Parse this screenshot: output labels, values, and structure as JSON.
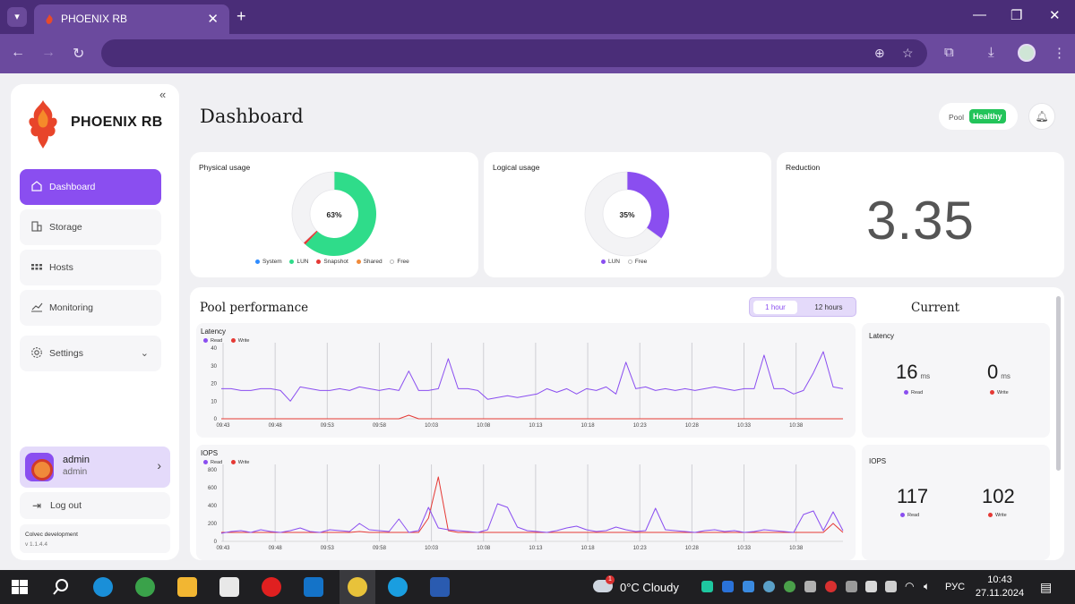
{
  "browser": {
    "tab_title": "PHOENIX RB",
    "tab_close": "✕",
    "new_tab": "+",
    "window_controls": [
      "—",
      "❐",
      "✕"
    ]
  },
  "sidebar": {
    "brand": "PHOENIX RB",
    "collapse": "«",
    "items": [
      {
        "label": "Dashboard",
        "icon": "home-icon"
      },
      {
        "label": "Storage",
        "icon": "building-icon"
      },
      {
        "label": "Hosts",
        "icon": "grid-icon"
      },
      {
        "label": "Monitoring",
        "icon": "chart-icon"
      },
      {
        "label": "Settings",
        "icon": "gear-icon"
      }
    ],
    "user": {
      "name": "admin",
      "role": "admin"
    },
    "logout": "Log out",
    "footer_line1": "Colvec development",
    "footer_line2": "v 1.1.4.4"
  },
  "header": {
    "title": "Dashboard",
    "pool_label": "Pool",
    "pool_status": "Healthy"
  },
  "cards": {
    "physical": {
      "title": "Physical usage",
      "percent_label": "63%",
      "legend": [
        {
          "name": "System",
          "color": "#2f8cff"
        },
        {
          "name": "LUN",
          "color": "#2fdc8a"
        },
        {
          "name": "Snapshot",
          "color": "#e53935"
        },
        {
          "name": "Shared",
          "color": "#f08a3a"
        },
        {
          "name": "Free",
          "color": "#ffffff"
        }
      ],
      "slices": [
        {
          "name": "LUN",
          "value": 62,
          "color": "#2fdc8a"
        },
        {
          "name": "Snapshot",
          "value": 1,
          "color": "#e53935"
        },
        {
          "name": "Free",
          "value": 37,
          "color": "#f3f3f5"
        }
      ]
    },
    "logical": {
      "title": "Logical usage",
      "percent_label": "35%",
      "legend": [
        {
          "name": "LUN",
          "color": "#8a4ef0"
        },
        {
          "name": "Free",
          "color": "#ffffff"
        }
      ],
      "slices": [
        {
          "name": "LUN",
          "value": 35,
          "color": "#8a4ef0"
        },
        {
          "name": "Free",
          "value": 65,
          "color": "#f3f3f5"
        }
      ]
    },
    "reduction": {
      "title": "Reduction",
      "value": "3.35"
    }
  },
  "performance": {
    "title": "Pool performance",
    "ranges": [
      "1 hour",
      "12 hours"
    ],
    "selected_range": "1 hour",
    "latency": {
      "title": "Latency",
      "legend": [
        "Read",
        "Write"
      ]
    },
    "iops": {
      "title": "IOPS",
      "legend": [
        "Read",
        "Write"
      ]
    }
  },
  "current": {
    "title": "Current",
    "latency": {
      "title": "Latency",
      "read": "16",
      "write": "0",
      "unit": "ms",
      "read_label": "Read",
      "write_label": "Write"
    },
    "iops": {
      "title": "IOPS",
      "read": "117",
      "write": "102",
      "read_label": "Read",
      "write_label": "Write"
    }
  },
  "colors": {
    "accent": "#8a4ef0",
    "read": "#8a4ef0",
    "write": "#e53935",
    "healthy": "#23c45a"
  },
  "chart_data": [
    {
      "type": "line",
      "title": "Latency",
      "x": [
        "09:43",
        "09:48",
        "09:53",
        "09:58",
        "10:03",
        "10:08",
        "10:13",
        "10:18",
        "10:23",
        "10:28",
        "10:33",
        "10:38"
      ],
      "ylim": [
        0,
        40
      ],
      "yticks": [
        0,
        10,
        20,
        30,
        40
      ],
      "series": [
        {
          "name": "Read",
          "color": "#8a4ef0",
          "values": [
            17,
            17,
            16,
            16,
            17,
            17,
            16,
            10,
            18,
            17,
            16,
            16,
            17,
            16,
            18,
            17,
            16,
            17,
            16,
            27,
            16,
            16,
            17,
            34,
            17,
            17,
            16,
            11,
            12,
            13,
            12,
            13,
            14,
            17,
            15,
            17,
            14,
            17,
            16,
            18,
            14,
            32,
            17,
            18,
            16,
            17,
            16,
            17,
            16,
            17,
            18,
            17,
            16,
            17,
            17,
            36,
            17,
            17,
            14,
            16,
            26,
            38,
            18,
            17
          ]
        },
        {
          "name": "Write",
          "color": "#e53935",
          "values": [
            0,
            0,
            0,
            0,
            0,
            0,
            0,
            0,
            0,
            0,
            0,
            0,
            0,
            0,
            0,
            0,
            0,
            0,
            0,
            2,
            0,
            0,
            0,
            0,
            0,
            0,
            0,
            0,
            0,
            0,
            0,
            0,
            0,
            0,
            0,
            0,
            0,
            0,
            0,
            0,
            0,
            0,
            0,
            0,
            0,
            0,
            0,
            0,
            0,
            0,
            0,
            0,
            0,
            0,
            0,
            0,
            0,
            0,
            0,
            0,
            0,
            0,
            0,
            0
          ]
        }
      ]
    },
    {
      "type": "line",
      "title": "IOPS",
      "x": [
        "09:43",
        "09:48",
        "09:53",
        "09:58",
        "10:03",
        "10:08",
        "10:13",
        "10:18",
        "10:23",
        "10:28",
        "10:33",
        "10:38"
      ],
      "ylim": [
        0,
        800
      ],
      "yticks": [
        0,
        200,
        400,
        600,
        800
      ],
      "series": [
        {
          "name": "Read",
          "color": "#8a4ef0",
          "values": [
            90,
            110,
            120,
            100,
            130,
            110,
            100,
            120,
            150,
            110,
            100,
            130,
            120,
            110,
            200,
            130,
            120,
            110,
            250,
            100,
            120,
            380,
            150,
            130,
            120,
            110,
            100,
            130,
            420,
            380,
            160,
            120,
            110,
            100,
            120,
            150,
            170,
            130,
            110,
            120,
            160,
            130,
            110,
            120,
            370,
            130,
            120,
            110,
            100,
            120,
            130,
            110,
            120,
            100,
            110,
            130,
            120,
            110,
            100,
            300,
            340,
            120,
            330,
            120
          ]
        },
        {
          "name": "Write",
          "color": "#e53935",
          "values": [
            100,
            100,
            100,
            100,
            100,
            100,
            100,
            100,
            100,
            100,
            100,
            100,
            100,
            100,
            110,
            100,
            100,
            100,
            100,
            100,
            100,
            260,
            720,
            120,
            100,
            100,
            100,
            100,
            100,
            100,
            100,
            100,
            100,
            100,
            100,
            100,
            100,
            100,
            100,
            100,
            100,
            100,
            100,
            100,
            100,
            100,
            100,
            100,
            100,
            100,
            100,
            100,
            100,
            100,
            100,
            100,
            100,
            100,
            100,
            100,
            100,
            100,
            200,
            100
          ]
        }
      ]
    }
  ],
  "taskbar": {
    "weather": "0°C  Cloudy",
    "weather_badge": "1",
    "lang": "РУС",
    "time": "10:43",
    "date": "27.11.2024"
  }
}
